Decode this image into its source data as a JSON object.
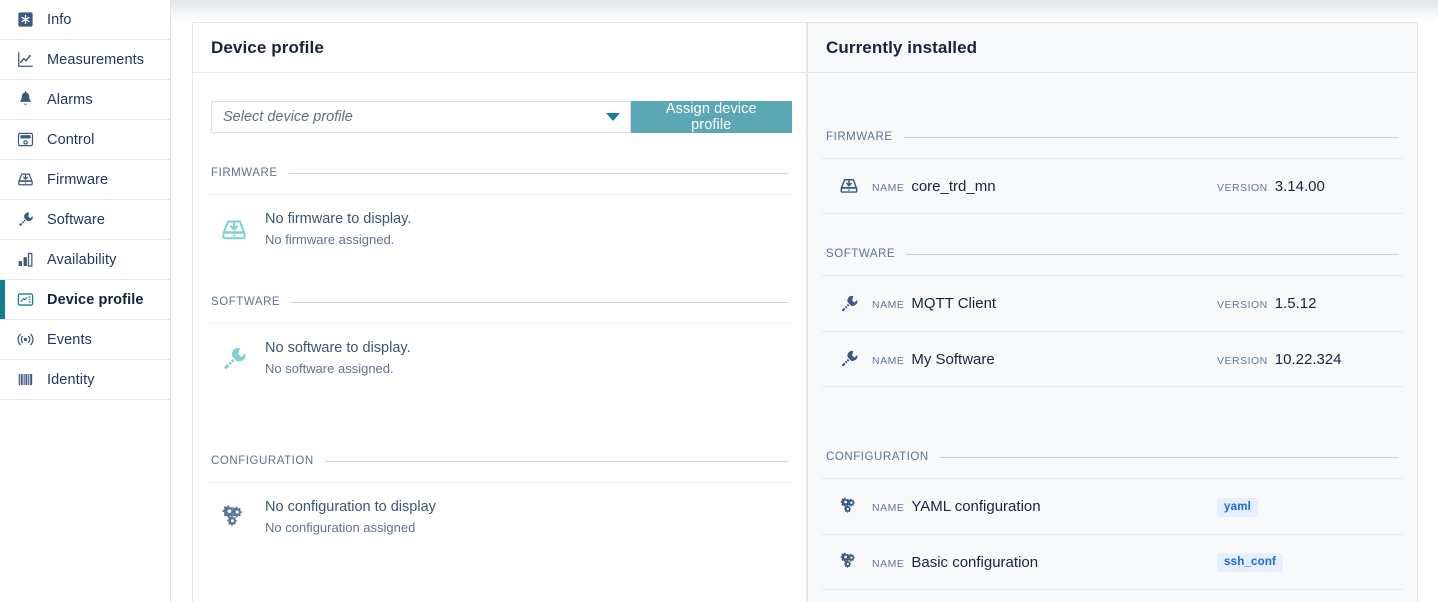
{
  "sidebar": {
    "items": [
      {
        "label": "Info",
        "icon": "asterisk-icon",
        "active": false
      },
      {
        "label": "Measurements",
        "icon": "chart-line-icon",
        "active": false
      },
      {
        "label": "Alarms",
        "icon": "bell-icon",
        "active": false
      },
      {
        "label": "Control",
        "icon": "control-panel-icon",
        "active": false
      },
      {
        "label": "Firmware",
        "icon": "firmware-download-icon",
        "active": false
      },
      {
        "label": "Software",
        "icon": "wrench-icon",
        "active": false
      },
      {
        "label": "Availability",
        "icon": "bar-chart-icon",
        "active": false
      },
      {
        "label": "Device profile",
        "icon": "device-profile-icon",
        "active": true
      },
      {
        "label": "Events",
        "icon": "broadcast-icon",
        "active": false
      },
      {
        "label": "Identity",
        "icon": "barcode-icon",
        "active": false
      }
    ]
  },
  "device_profile_panel": {
    "title": "Device profile",
    "select": {
      "placeholder": "Select device profile",
      "value": "",
      "caret_icon": "chevron-down-icon"
    },
    "assign_button": "Assign device profile",
    "sections": [
      {
        "label": "FIRMWARE",
        "icon": "firmware-download-icon",
        "empty_title": "No firmware to display.",
        "empty_sub": "No firmware assigned."
      },
      {
        "label": "SOFTWARE",
        "icon": "wrench-icon",
        "empty_title": "No software to display.",
        "empty_sub": "No software assigned."
      },
      {
        "label": "CONFIGURATION",
        "icon": "gears-icon",
        "empty_title": "No configuration to display",
        "empty_sub": "No configuration assigned"
      }
    ]
  },
  "installed_panel": {
    "title": "Currently installed",
    "labels": {
      "name": "NAME",
      "version": "VERSION"
    },
    "sections": [
      {
        "label": "FIRMWARE",
        "rows": [
          {
            "icon": "firmware-download-icon",
            "name": "core_trd_mn",
            "version": "3.14.00"
          }
        ]
      },
      {
        "label": "SOFTWARE",
        "rows": [
          {
            "icon": "wrench-icon",
            "name": "MQTT Client",
            "version": "1.5.12"
          },
          {
            "icon": "wrench-icon",
            "name": "My Software",
            "version": "10.22.324"
          }
        ]
      },
      {
        "label": "CONFIGURATION",
        "rows": [
          {
            "icon": "gears-icon",
            "name": "YAML configuration",
            "badge": "yaml"
          },
          {
            "icon": "gears-icon",
            "name": "Basic configuration",
            "badge": "ssh_conf"
          }
        ]
      }
    ]
  },
  "colors": {
    "accent_teal": "#177f8f",
    "button_teal": "#5ca7b6",
    "badge_text": "#1868d4",
    "badge_bg": "#e5efff",
    "text_dark": "#16243f",
    "section_label": "#5b7294",
    "empty_icon": "#7fd0cb"
  }
}
